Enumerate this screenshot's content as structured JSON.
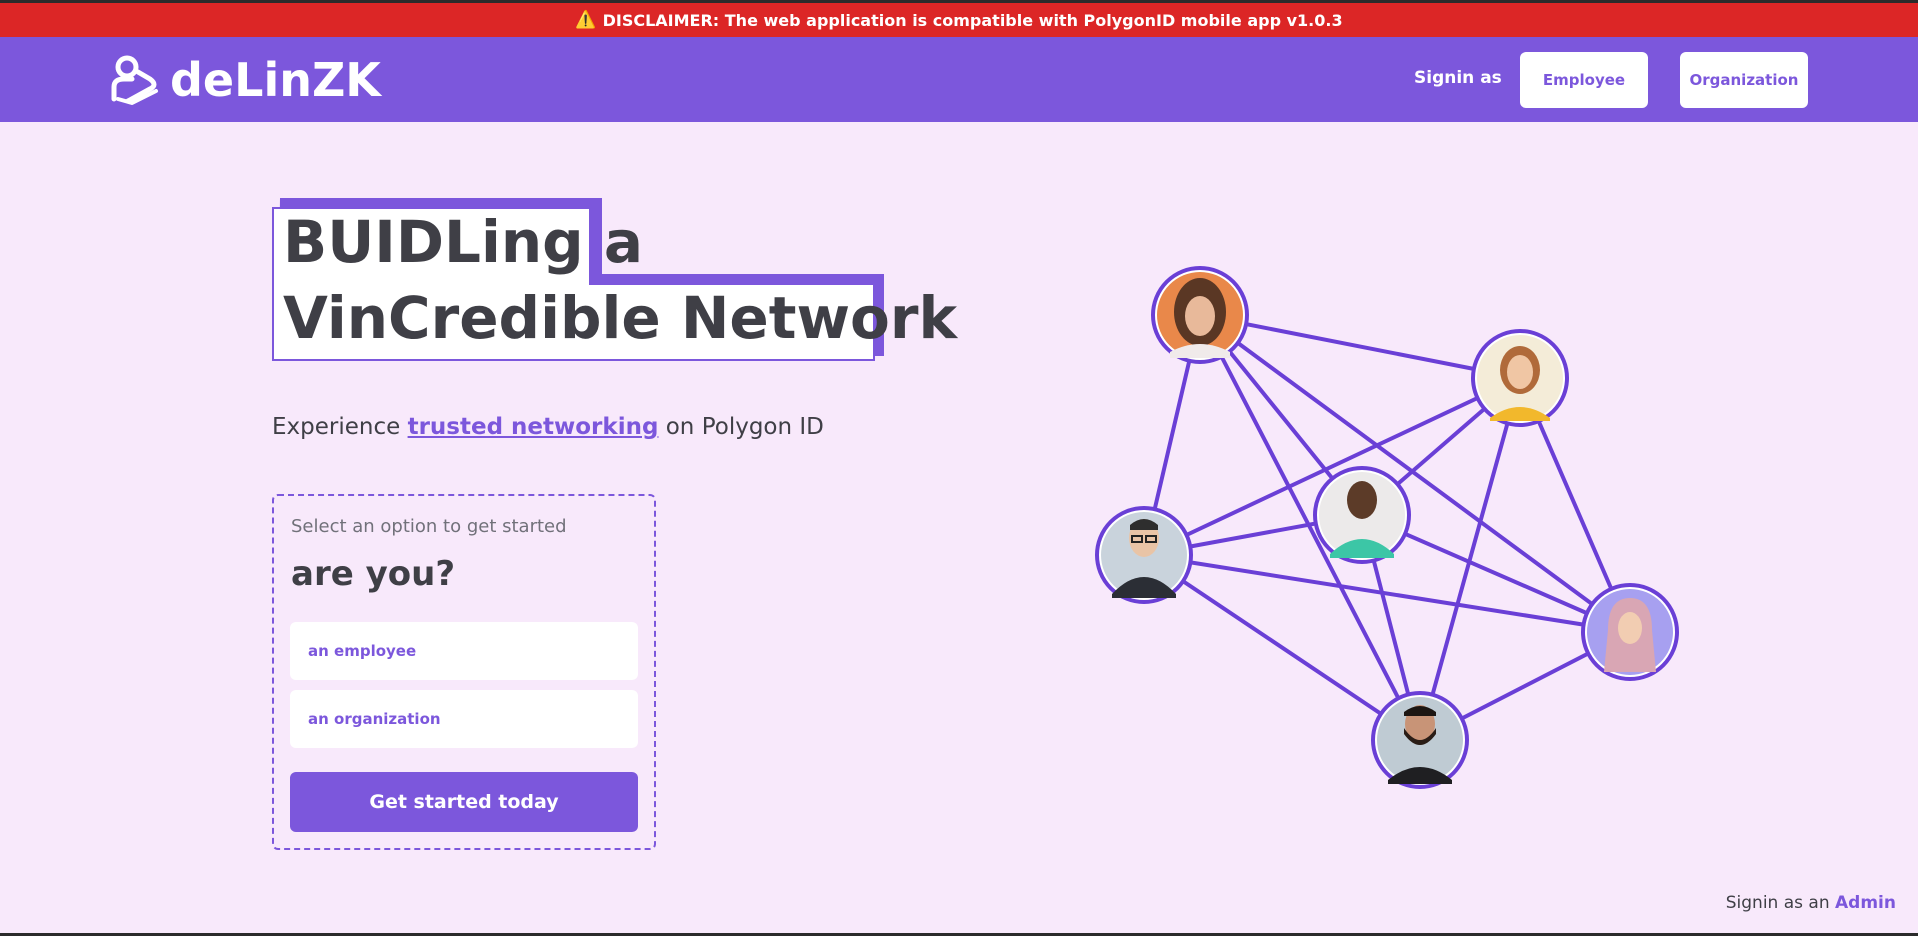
{
  "disclaimer": {
    "icon": "warning-icon",
    "text": "DISCLAIMER: The web application is compatible with PolygonID mobile app v1.0.3"
  },
  "brand": {
    "name": "deLinZK"
  },
  "nav": {
    "signin_label": "Signin as",
    "employee_button": "Employee",
    "organization_button": "Organization"
  },
  "hero": {
    "headline_line1": "BUIDLing a",
    "headline_line2": "VinCredible Network",
    "subtitle_prefix": "Experience",
    "subtitle_link": "trusted networking",
    "subtitle_suffix": "on Polygon ID"
  },
  "card": {
    "hint": "Select an option to get started",
    "question": "are you?",
    "option_employee": "an employee",
    "option_organization": "an organization",
    "cta": "Get started today"
  },
  "footer": {
    "admin_prefix": "Signin as an",
    "admin_link": "Admin"
  },
  "colors": {
    "accent": "#7c57dc",
    "disclaimer_bg": "#dc2626",
    "page_bg": "#f8e9fb"
  }
}
